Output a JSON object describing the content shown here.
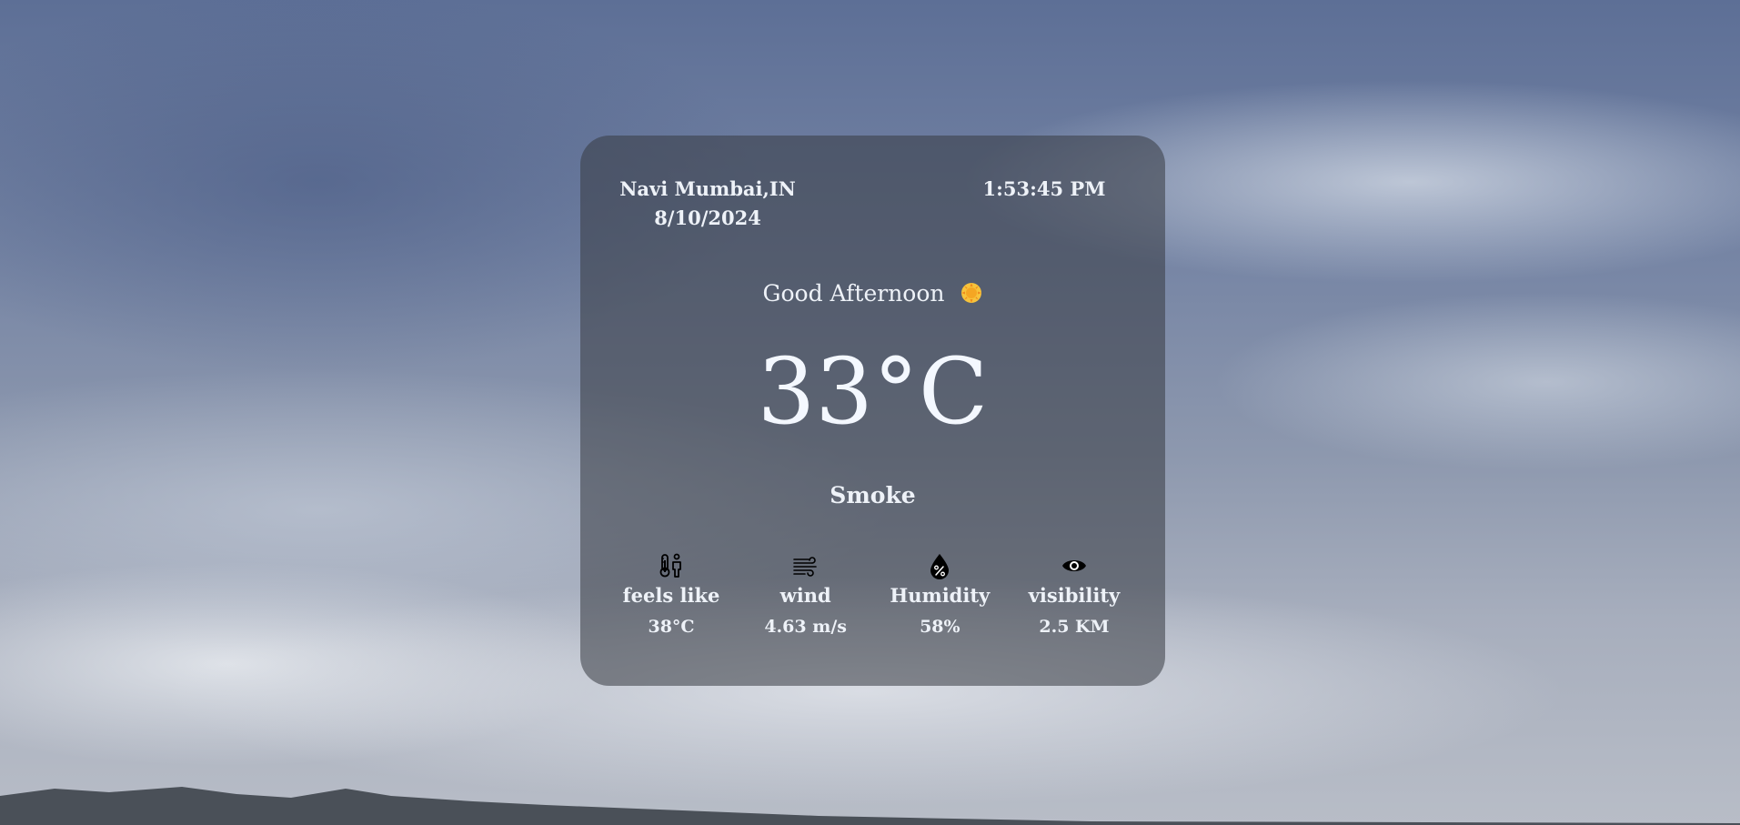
{
  "location": {
    "city": "Navi Mumbai,IN",
    "date": "8/10/2024"
  },
  "clock": {
    "time": "1:53:45 PM"
  },
  "greeting": {
    "text": "Good Afternoon",
    "icon": "sun-icon"
  },
  "weather": {
    "temperature": "33°C",
    "condition": "Smoke"
  },
  "stats": [
    {
      "icon": "thermometer-person-icon",
      "label": "feels like",
      "value": "38°C"
    },
    {
      "icon": "wind-icon",
      "label": "wind",
      "value": "4.63 m/s"
    },
    {
      "icon": "humidity-drop-icon",
      "label": "Humidity",
      "value": "58%"
    },
    {
      "icon": "eye-icon",
      "label": "visibility",
      "value": "2.5 KM"
    }
  ],
  "colors": {
    "card": "#373a42",
    "text": "#eef2f8",
    "icon": "#000000",
    "sun": "#f5a623"
  }
}
